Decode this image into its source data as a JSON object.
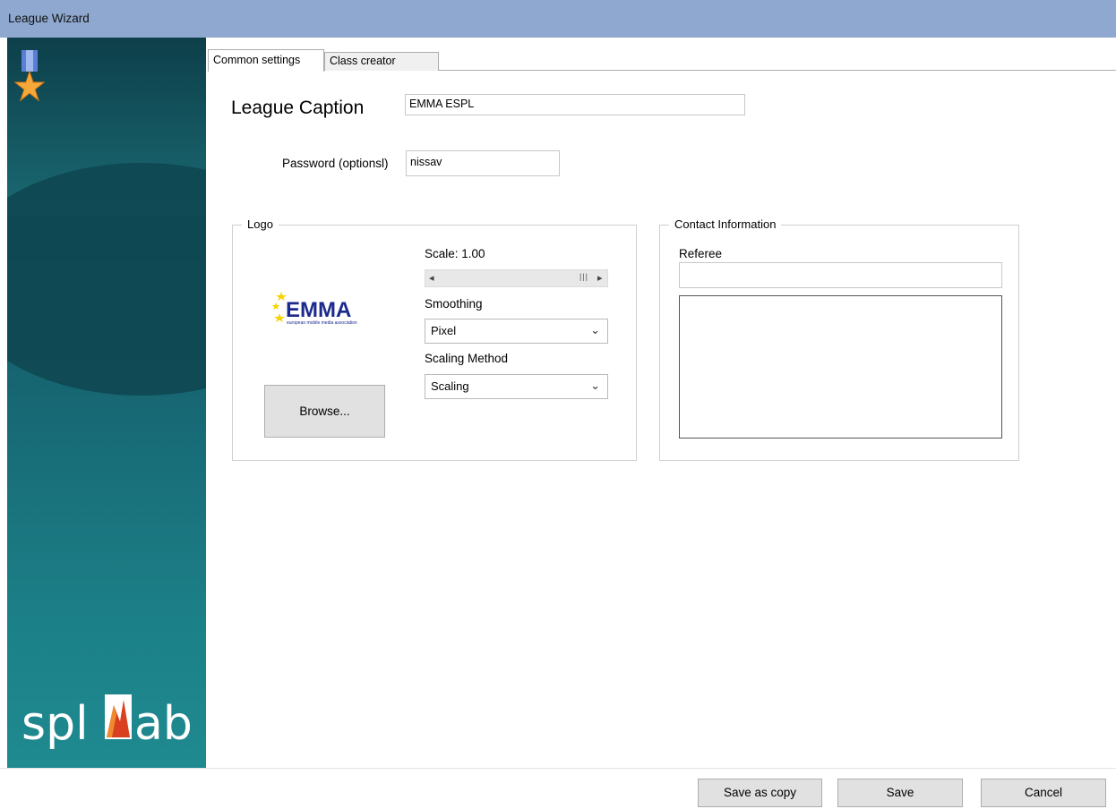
{
  "window": {
    "title": "League Wizard"
  },
  "sidebar": {
    "brand_text_left": "spl",
    "brand_text_right": "ab"
  },
  "tabs": [
    {
      "label": "Common settings",
      "active": true
    },
    {
      "label": "Class creator",
      "active": false
    }
  ],
  "form": {
    "league_caption_label": "League Caption",
    "league_caption_value": "EMMA ESPL",
    "password_label": "Password (optionsl)",
    "password_value": "nissav"
  },
  "logo_group": {
    "title": "Logo",
    "logo_text": "EMMA",
    "logo_subtext": "european mobile media association",
    "scale_label": "Scale: 1.00",
    "scale_value": 1.0,
    "smoothing_label": "Smoothing",
    "smoothing_value": "Pixel",
    "scaling_method_label": "Scaling Method",
    "scaling_method_value": "Scaling",
    "browse_label": "Browse..."
  },
  "contact_group": {
    "title": "Contact Information",
    "referee_label": "Referee",
    "referee_value": "",
    "notes_value": ""
  },
  "footer": {
    "save_as_copy_label": "Save as copy",
    "save_label": "Save",
    "cancel_label": "Cancel"
  },
  "colors": {
    "titlebar": "#8ea8cf",
    "sidebar_dark": "#0f4a57",
    "sidebar_light": "#1f8a90",
    "logo_blue": "#1b2a8c",
    "logo_star": "#f5d400"
  }
}
